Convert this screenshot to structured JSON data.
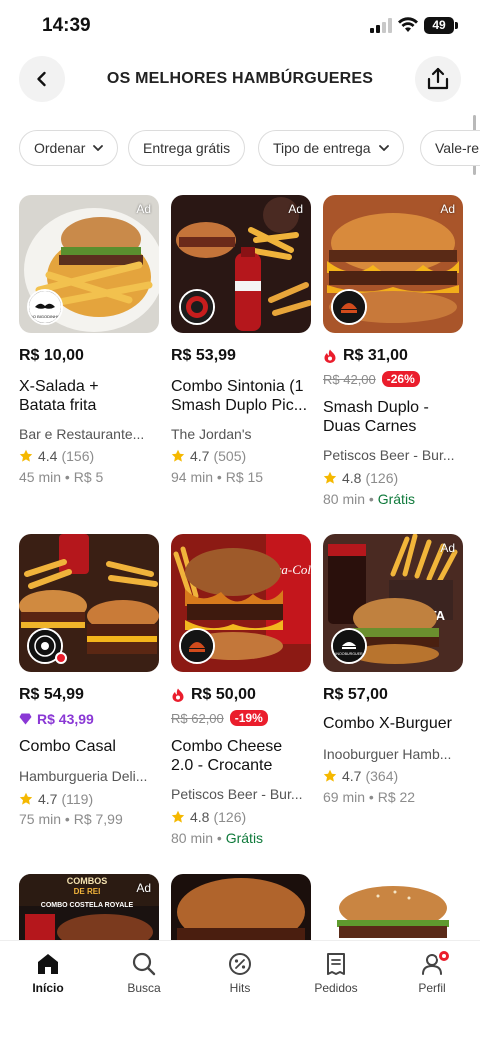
{
  "status_bar": {
    "time": "14:39",
    "battery": "49"
  },
  "header": {
    "title": "OS MELHORES HAMBÚRGUERES"
  },
  "filters": [
    {
      "label": "Ordenar",
      "dropdown": true
    },
    {
      "label": "Entrega grátis",
      "dropdown": false
    },
    {
      "label": "Tipo de entrega",
      "dropdown": true
    },
    {
      "label": "Vale-re",
      "dropdown": false
    }
  ],
  "products": [
    {
      "price": "R$ 10,00",
      "name_lines": [
        "X-Salada +",
        "Batata frita"
      ],
      "store": "Bar e Restaurante...",
      "rating": "4.4",
      "reviews": "(156)",
      "time": "45 min",
      "delivery": "R$ 5",
      "ad": "Ad"
    },
    {
      "price": "R$ 53,99",
      "name_lines": [
        "Combo Sintonia (1",
        "Smash Duplo Pic..."
      ],
      "store": "The Jordan's",
      "rating": "4.7",
      "reviews": "(505)",
      "time": "94 min",
      "delivery": "R$ 15",
      "ad": "Ad"
    },
    {
      "price": "R$ 31,00",
      "old_price": "R$ 42,00",
      "discount": "-26%",
      "name_lines": [
        "Smash Duplo -",
        "Duas Carnes"
      ],
      "store": "Petiscos Beer - Bur...",
      "rating": "4.8",
      "reviews": "(126)",
      "time": "80 min",
      "delivery": "Grátis",
      "ad": "Ad"
    },
    {
      "price": "R$ 54,99",
      "club_price": "R$ 43,99",
      "name_lines": [
        "Combo Casal"
      ],
      "store": "Hamburgueria Deli...",
      "rating": "4.7",
      "reviews": "(119)",
      "time": "75 min",
      "delivery": "R$ 7,99"
    },
    {
      "price": "R$ 50,00",
      "old_price": "R$ 62,00",
      "discount": "-19%",
      "name_lines": [
        "Combo Cheese",
        "2.0 - Crocante"
      ],
      "store": "Petiscos Beer - Bur...",
      "rating": "4.8",
      "reviews": "(126)",
      "time": "80 min",
      "delivery": "Grátis"
    },
    {
      "price": "R$ 57,00",
      "name_lines": [
        "Combo X-Burguer"
      ],
      "store": "Inooburguer Hamb...",
      "rating": "4.7",
      "reviews": "(364)",
      "time": "69 min",
      "delivery": "R$ 22",
      "ad": "Ad"
    }
  ],
  "thumb_texts": {
    "logo1": "DO BIGODINHO",
    "logo6": "INOOBURGUER",
    "cola": "Coca-Cola",
    "fata": "FATA",
    "combo7_line1": "COMBOS",
    "combo7_line2": "DE REI",
    "combo7_line3": "COMBO COSTELA ROYALE",
    "ad7": "Ad"
  },
  "bottom_nav": [
    {
      "label": "Início",
      "icon": "home-icon",
      "active": true
    },
    {
      "label": "Busca",
      "icon": "search-icon",
      "active": false
    },
    {
      "label": "Hits",
      "icon": "hits-icon",
      "active": false
    },
    {
      "label": "Pedidos",
      "icon": "orders-icon",
      "active": false
    },
    {
      "label": "Perfil",
      "icon": "profile-icon",
      "active": false
    }
  ],
  "colors": {
    "brand_red": "#ea1d2c",
    "club_purple": "#8a38d5",
    "free_green": "#0f7a3b",
    "star": "#f5b800"
  }
}
